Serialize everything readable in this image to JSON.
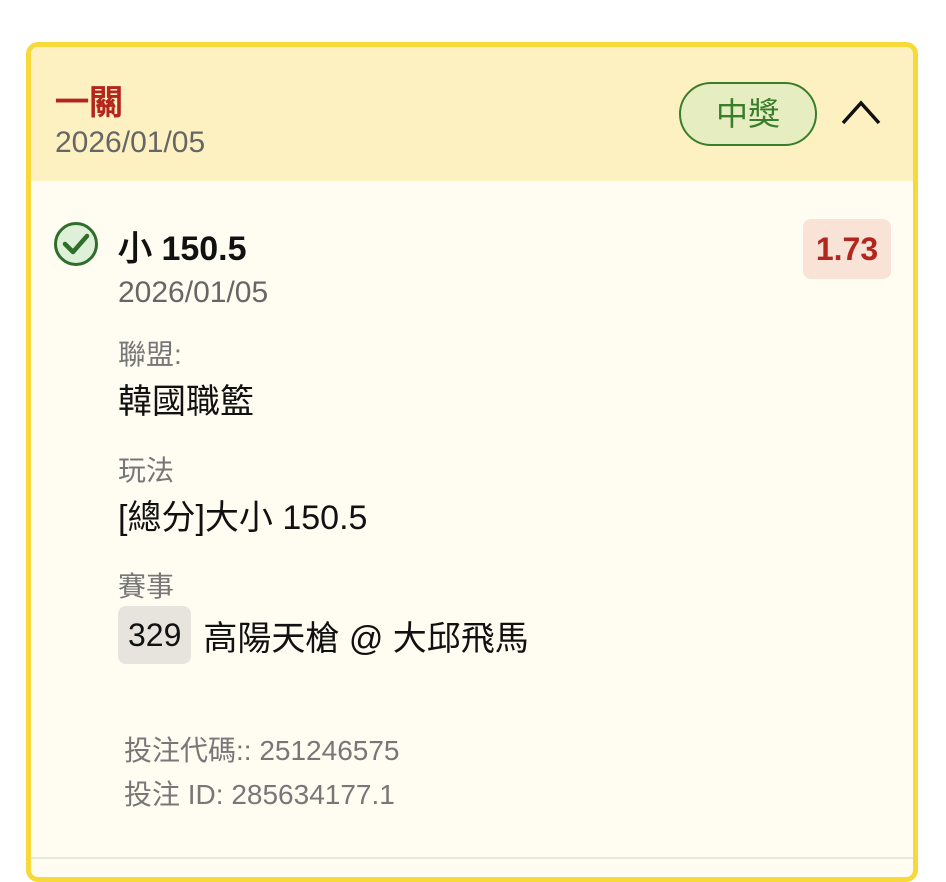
{
  "header": {
    "title": "一關",
    "date": "2026/01/05",
    "status": "中獎"
  },
  "selection": {
    "label": "小 150.5",
    "date": "2026/01/05",
    "odds": "1.73"
  },
  "fields": {
    "league_label": "聯盟:",
    "league_value": "韓國職籃",
    "market_label": "玩法",
    "market_value": "[總分]大小 150.5",
    "event_label": "賽事",
    "event_number": "329",
    "event_name": "高陽天槍 @ 大邱飛馬"
  },
  "meta": {
    "bet_code": "投注代碼:: 251246575",
    "bet_id": "投注 ID: 285634177.1"
  },
  "colors": {
    "border": "#f7d93a",
    "header_bg": "#fdf1c2",
    "title_red": "#b3261e",
    "win_green": "#3a7d2a"
  },
  "icons": {
    "check": "check-circle-icon",
    "collapse": "chevron-up-icon"
  }
}
